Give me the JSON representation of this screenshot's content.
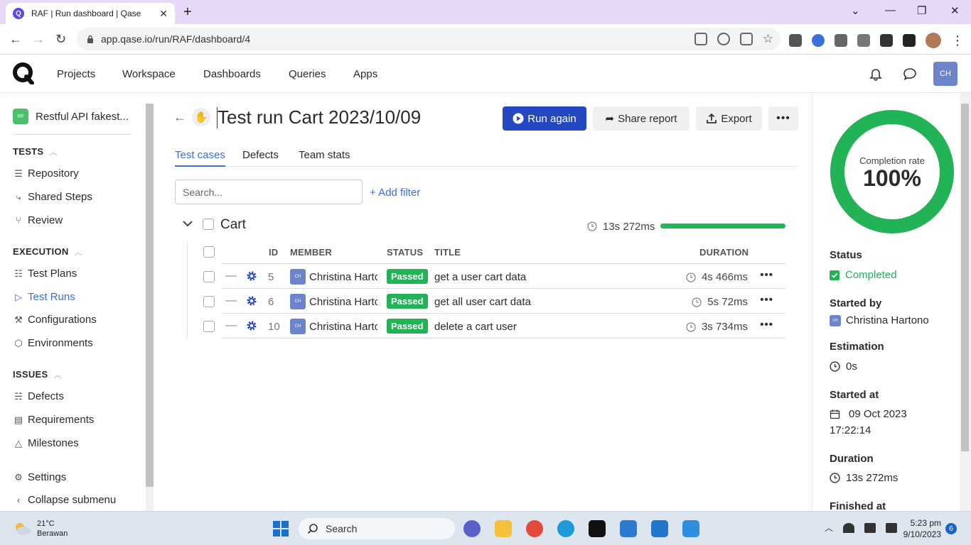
{
  "browser": {
    "tab_title": "RAF | Run dashboard | Qase",
    "tab_favicon": "Q",
    "tab_close": "✕",
    "new_tab": "+",
    "url": "app.qase.io/run/RAF/dashboard/4"
  },
  "header": {
    "nav": [
      "Projects",
      "Workspace",
      "Dashboards",
      "Queries",
      "Apps"
    ],
    "avatar_initials": "CH"
  },
  "sidebar": {
    "project_avatar": "RF",
    "project_name": "Restful API fakest...",
    "sections": [
      {
        "title": "TESTS",
        "items": [
          "Repository",
          "Shared Steps",
          "Review"
        ]
      },
      {
        "title": "EXECUTION",
        "items": [
          "Test Plans",
          "Test Runs",
          "Configurations",
          "Environments"
        ]
      },
      {
        "title": "ISSUES",
        "items": [
          "Defects",
          "Requirements",
          "Milestones"
        ]
      }
    ],
    "settings": "Settings",
    "collapse": "Collapse submenu"
  },
  "run": {
    "title": "Test run Cart 2023/10/09",
    "run_again": "Run again",
    "share": "Share report",
    "export": "Export",
    "more": "•••"
  },
  "tabs": [
    "Test cases",
    "Defects",
    "Team stats"
  ],
  "search": {
    "placeholder": "Search..."
  },
  "add_filter": "+ Add filter",
  "suite": {
    "name": "Cart",
    "duration": "13s 272ms",
    "progress": 1.0
  },
  "table": {
    "headers": {
      "id": "ID",
      "member": "MEMBER",
      "status": "STATUS",
      "title": "TITLE",
      "duration": "DURATION"
    },
    "rows": [
      {
        "id": "5",
        "avatar": "CH",
        "member": "Christina Hartono",
        "status": "Passed",
        "title": "get a user cart data",
        "duration": "4s 466ms"
      },
      {
        "id": "6",
        "avatar": "CH",
        "member": "Christina Hartono",
        "status": "Passed",
        "title": "get all user cart data",
        "duration": "5s 72ms"
      },
      {
        "id": "10",
        "avatar": "CH",
        "member": "Christina Hartono",
        "status": "Passed",
        "title": "delete a cart user",
        "duration": "3s 734ms"
      }
    ]
  },
  "panel": {
    "completion_label": "Completion rate",
    "completion_value": "100%",
    "completion_fraction": 1.0,
    "status_label": "Status",
    "status_value": "Completed",
    "started_by_label": "Started by",
    "started_by_avatar": "CH",
    "started_by_value": "Christina Hartono",
    "estimation_label": "Estimation",
    "estimation_value": "0s",
    "started_at_label": "Started at",
    "started_at_date": "09 Oct 2023",
    "started_at_time": "17:22:14",
    "duration_label": "Duration",
    "duration_value": "13s 272ms",
    "finished_at_label": "Finished at"
  },
  "taskbar": {
    "temp": "21°C",
    "weather": "Berawan",
    "search": "Search",
    "time": "5:23 pm",
    "date": "9/10/2023",
    "notifications": "6"
  },
  "colors": {
    "primary": "#2447c2",
    "link": "#3d6fd8",
    "success": "#21b356",
    "progress": "#1db954"
  }
}
